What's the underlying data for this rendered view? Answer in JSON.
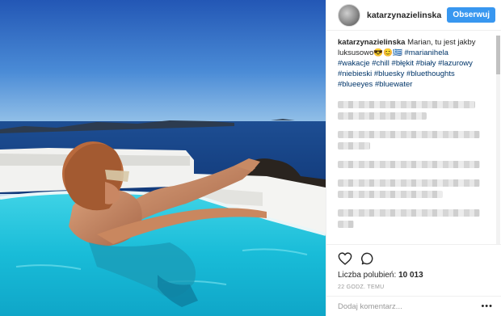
{
  "post": {
    "username": "katarzynazielinska",
    "follow_label": "Obserwuj"
  },
  "caption": {
    "username": "katarzynazielinska",
    "text": "Marian, tu jest jakby luksusowo😎😊🇬🇷",
    "hashtags": [
      "#marianihela",
      "#wakacje",
      "#chill",
      "#błękit",
      "#biały",
      "#lazurowy",
      "#niebieski",
      "#bluesky",
      "#bluethoughts",
      "#blueeyes",
      "#bluewater"
    ]
  },
  "footer": {
    "likes_label": "Liczba polubień:",
    "likes_count": "10 013",
    "time": "22 GODZ. TEMU",
    "comment_placeholder": "Dodaj komentarz...",
    "more_glyph": "•••"
  },
  "icons": {
    "like": "heart-icon",
    "comment": "comment-icon",
    "more": "more-options-icon"
  },
  "colors": {
    "follow_button": "#3897f0",
    "hashtag": "#003569",
    "pool_water": "#1fc3dd",
    "sea": "#1d4e93"
  }
}
